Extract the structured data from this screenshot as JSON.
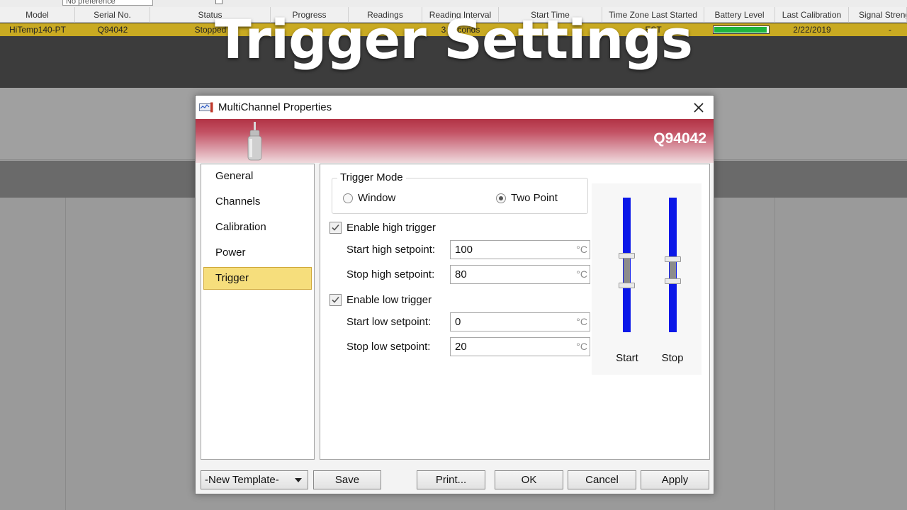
{
  "background_app": {
    "filter_combo_value": "No preference",
    "columns": [
      "Model",
      "Serial No.",
      "Status",
      "Progress",
      "Readings",
      "Reading Interval",
      "Start Time",
      "Time Zone Last Started",
      "Battery Level",
      "Last Calibration",
      "Signal Strength"
    ],
    "row": {
      "model": "HiTemp140-PT",
      "serial": "Q94042",
      "status": "Stopped",
      "interval": "3 seconds",
      "timezone": "EST",
      "battery_fraction": 0.98,
      "last_calibration": "2/22/2019",
      "signal": "-"
    }
  },
  "overlay_title": "Trigger Settings",
  "dialog": {
    "title": "MultiChannel Properties",
    "serial": "Q94042",
    "nav": [
      {
        "label": "General"
      },
      {
        "label": "Channels"
      },
      {
        "label": "Calibration"
      },
      {
        "label": "Power"
      },
      {
        "label": "Trigger"
      }
    ],
    "active_nav": "Trigger",
    "trigger_mode": {
      "legend": "Trigger Mode",
      "options": [
        "Window",
        "Two Point"
      ],
      "selected": "Two Point"
    },
    "high_trigger": {
      "label": "Enable high trigger",
      "checked": true,
      "start_label": "Start high setpoint:",
      "start_value": "100",
      "stop_label": "Stop high setpoint:",
      "stop_value": "80"
    },
    "low_trigger": {
      "label": "Enable low trigger",
      "checked": true,
      "start_label": "Start low setpoint:",
      "start_value": "0",
      "stop_label": "Stop low setpoint:",
      "stop_value": "20"
    },
    "unit": "°C",
    "sliders": {
      "start": {
        "label": "Start",
        "upper_fraction": 0.43,
        "lower_fraction": 0.65
      },
      "stop": {
        "label": "Stop",
        "upper_fraction": 0.46,
        "lower_fraction": 0.62
      }
    },
    "buttons": {
      "template": "-New Template-",
      "save": "Save",
      "print": "Print...",
      "ok": "OK",
      "cancel": "Cancel",
      "apply": "Apply"
    },
    "colors": {
      "accent_banner": "#b23345",
      "nav_highlight": "#f6de7c",
      "slider_track": "#0b18e8",
      "row_highlight": "#c9aa22"
    }
  }
}
